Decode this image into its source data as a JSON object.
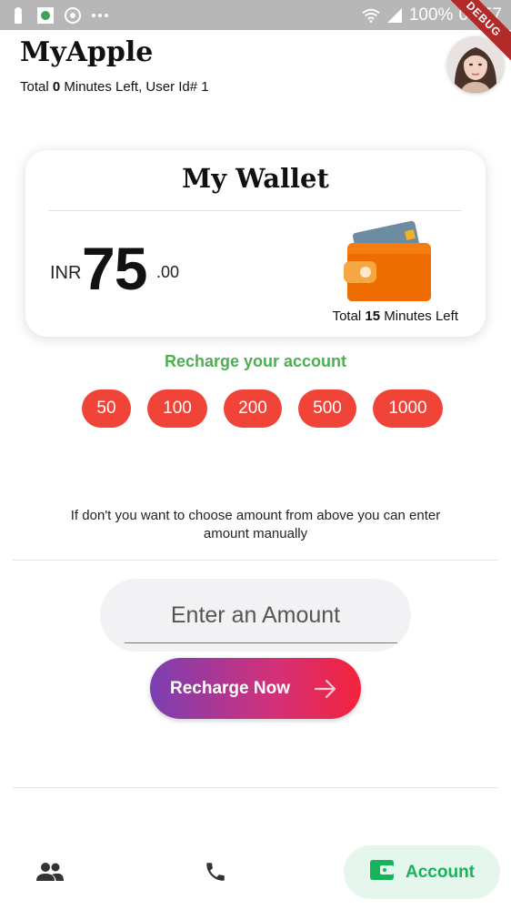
{
  "status_bar": {
    "battery": "100%",
    "time": "06:57",
    "debug_label": "DEBUG"
  },
  "header": {
    "title": "MyApple",
    "subtitle_prefix": "Total ",
    "subtitle_minutes": "0",
    "subtitle_suffix": " Minutes Left, User Id# 1"
  },
  "wallet": {
    "title": "My Wallet",
    "currency": "INR",
    "amount_int": "75",
    "amount_dec": ".00",
    "minutes_prefix": "Total ",
    "minutes_value": "15",
    "minutes_suffix": " Minutes Left"
  },
  "recharge": {
    "label": "Recharge your account",
    "amounts": [
      "50",
      "100",
      "200",
      "500",
      "1000"
    ],
    "info_text": "If don't you want to choose amount from above you can enter amount manually",
    "input_placeholder": "Enter an Amount",
    "button_label": "Recharge Now"
  },
  "bottom_nav": {
    "items": [
      {
        "icon": "people-icon",
        "label": ""
      },
      {
        "icon": "phone-icon",
        "label": ""
      },
      {
        "icon": "wallet-icon",
        "label": "Account",
        "active": true
      }
    ]
  },
  "colors": {
    "accent_red": "#f04438",
    "green": "#4caf50",
    "nav_active_bg": "#e5f7ec",
    "nav_active_fg": "#17b35a",
    "gradient_start": "#7b3fb3",
    "gradient_end": "#f4233b"
  }
}
